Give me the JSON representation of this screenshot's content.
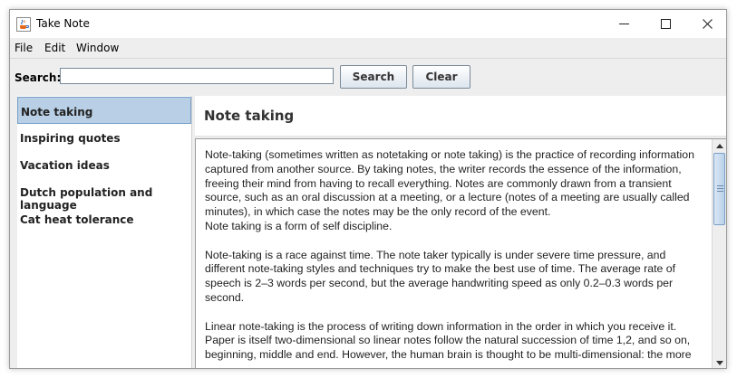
{
  "window": {
    "title": "Take Note"
  },
  "menu": [
    "File",
    "Edit",
    "Window"
  ],
  "search": {
    "label": "Search:",
    "value": "",
    "search_button": "Search",
    "clear_button": "Clear"
  },
  "sidebar": {
    "items": [
      {
        "label": "Note taking",
        "selected": true
      },
      {
        "label": "Inspiring quotes",
        "selected": false
      },
      {
        "label": "Vacation ideas",
        "selected": false
      },
      {
        "label": "Dutch population and language",
        "selected": false
      },
      {
        "label": "Cat heat tolerance",
        "selected": false
      }
    ]
  },
  "content": {
    "title": "Note taking",
    "paragraphs": [
      "Note-taking (sometimes written as notetaking or note taking) is the practice of recording information\ncaptured from another source. By taking notes, the writer records the essence of the information,\nfreeing their mind from having to recall everything. Notes are commonly drawn from a transient\nsource, such as an oral discussion at a meeting, or a lecture (notes of a meeting are usually called\nminutes), in which case the notes may be the only record of the event.\nNote taking is a form of self discipline.",
      "Note-taking is a race against time. The note taker typically is under severe time pressure, and\ndifferent note-taking styles and techniques try to make the best use of time. The average rate of\nspeech is 2–3 words per second, but the average handwriting speed as only 0.2–0.3 words per\nsecond.",
      "Linear note-taking is the process of writing down information in the order in which you receive it.\nPaper is itself two-dimensional so linear notes follow the natural succession of time 1,2, and so on,\nbeginning, middle and end. However, the human brain is thought to be multi-dimensional: the more"
    ]
  },
  "colors": {
    "selection": "#b8cfe5",
    "selection_border": "#7aa0c8"
  }
}
